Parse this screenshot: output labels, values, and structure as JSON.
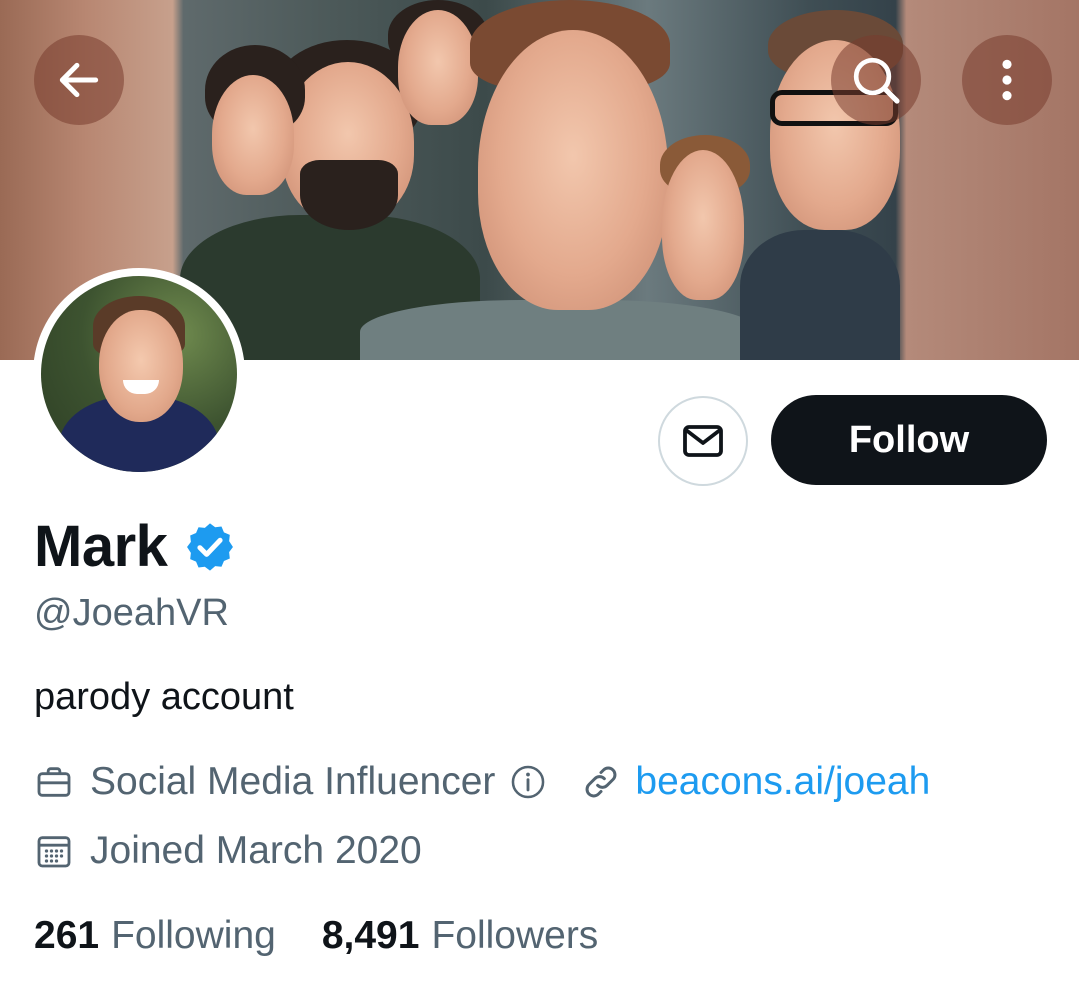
{
  "header": {
    "back_icon": "arrow-left-icon",
    "search_icon": "search-icon",
    "more_icon": "more-vertical-icon"
  },
  "profile": {
    "display_name": "Mark",
    "verified": true,
    "handle": "@JoeahVR",
    "bio": "parody account",
    "category": "Social Media Influencer",
    "website": "beacons.ai/joeah",
    "joined": "Joined March 2020"
  },
  "actions": {
    "message_icon": "envelope-icon",
    "follow_label": "Follow"
  },
  "stats": {
    "following_count": "261",
    "following_label": "Following",
    "followers_count": "8,491",
    "followers_label": "Followers"
  },
  "colors": {
    "accent": "#1d9bf0",
    "text_primary": "#0f1419",
    "text_secondary": "#536471",
    "follow_bg": "#0f1419"
  }
}
